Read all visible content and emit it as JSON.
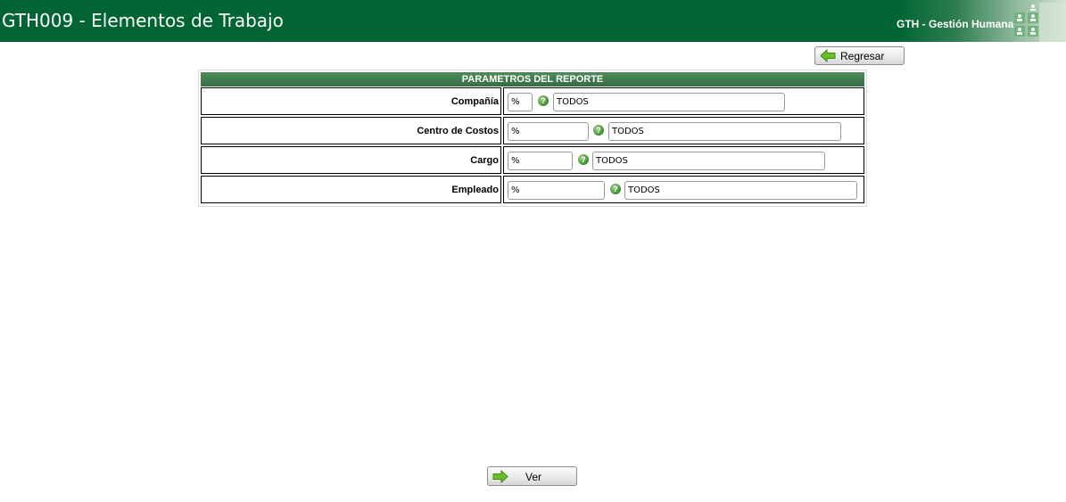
{
  "header": {
    "title": "GTH009 - Elementos de Trabajo",
    "module": "GTH - Gestión Humana",
    "background_color": "#016433"
  },
  "toolbar": {
    "back_label": "Regresar",
    "view_label": "Ver",
    "arrow_icon": "green-arrow-right-icon"
  },
  "params": {
    "title": "PARAMETROS DEL REPORTE",
    "help_glyph": "?",
    "rows": [
      {
        "label": "Compañía",
        "code_value": "%",
        "desc_value": "TODOS"
      },
      {
        "label": "Centro de Costos",
        "code_value": "%",
        "desc_value": "TODOS"
      },
      {
        "label": "Cargo",
        "code_value": "%",
        "desc_value": "TODOS"
      },
      {
        "label": "Empleado",
        "code_value": "%",
        "desc_value": "TODOS"
      }
    ]
  }
}
